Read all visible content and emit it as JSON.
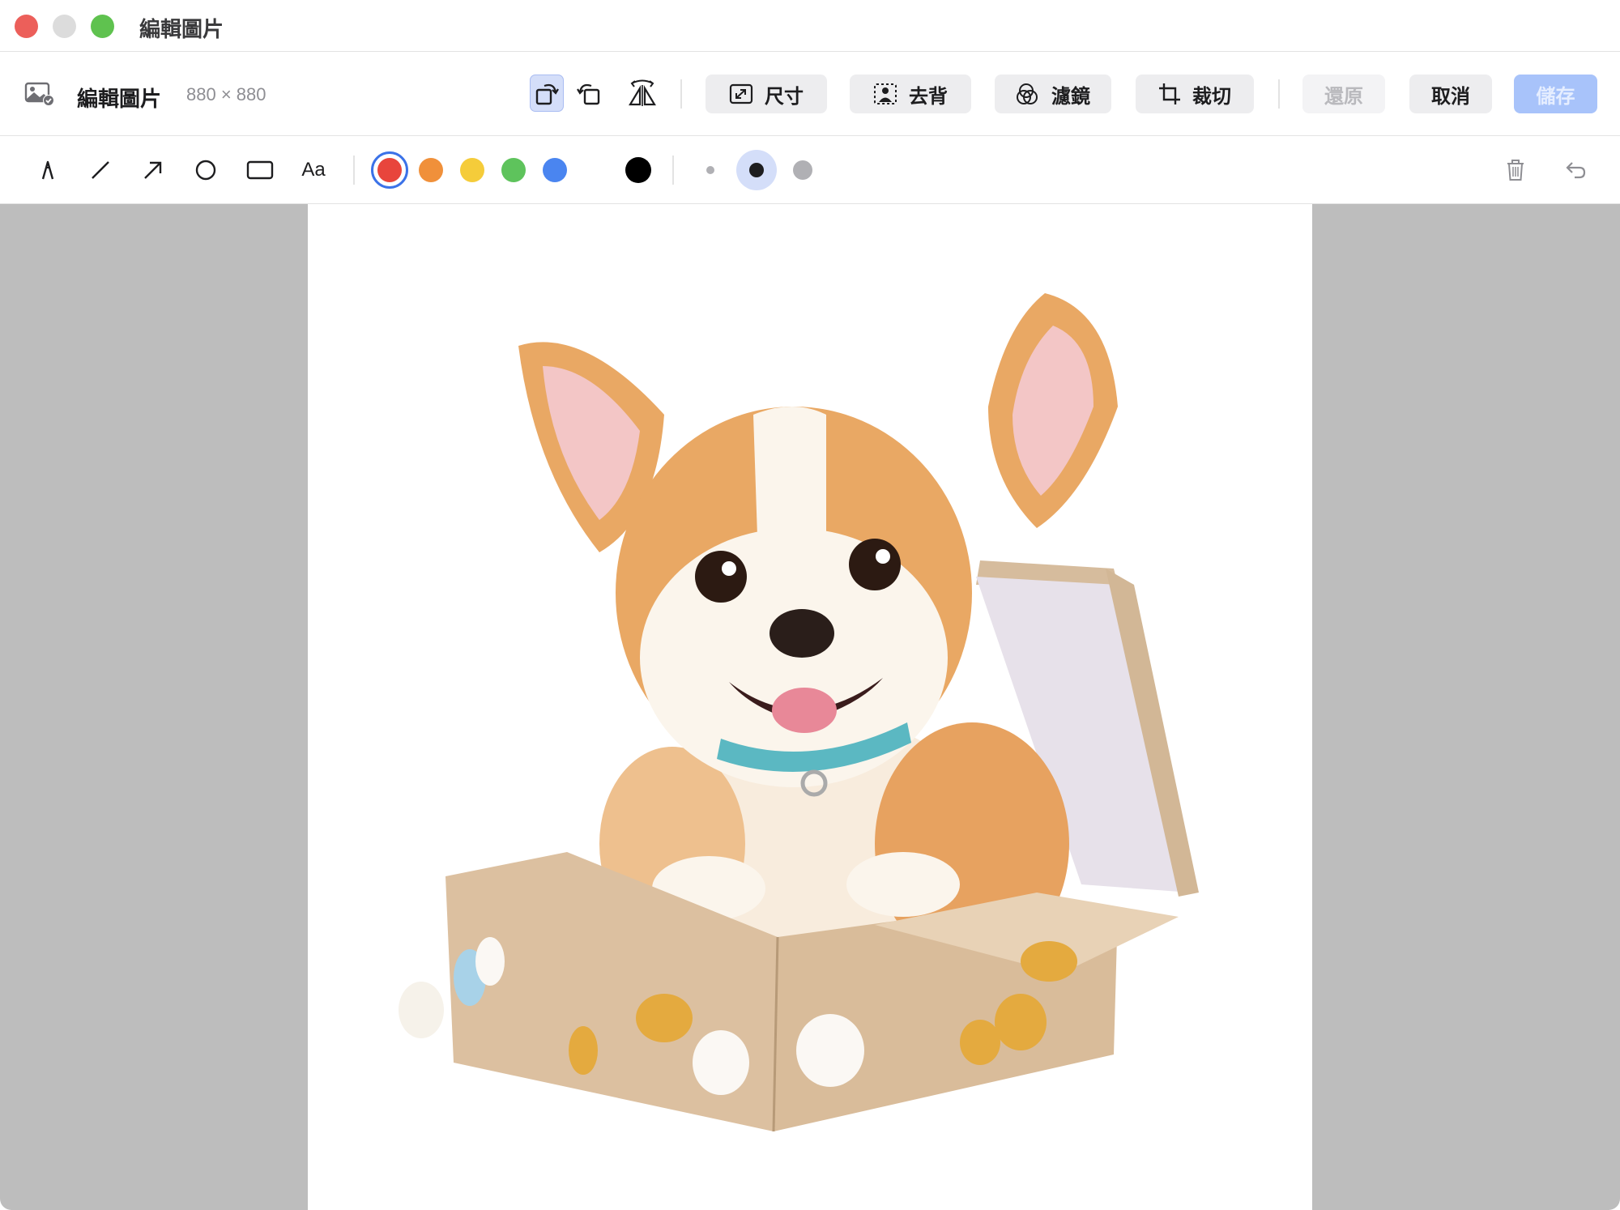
{
  "window": {
    "title": "編輯圖片"
  },
  "document": {
    "name": "編輯圖片",
    "dimensions": "880 × 880"
  },
  "toolbar": {
    "size_label": "尺寸",
    "remove_bg_label": "去背",
    "filter_label": "濾鏡",
    "crop_label": "裁切",
    "revert_label": "還原",
    "cancel_label": "取消",
    "save_label": "儲存"
  },
  "markup": {
    "text_tool_label": "Aa",
    "colors": [
      "#e8453c",
      "#f0903a",
      "#f5cc3a",
      "#5ec35c",
      "#4a85f0",
      "#000000"
    ],
    "selected_color": "#e8453c",
    "stroke_sizes": [
      "small",
      "medium",
      "large"
    ],
    "selected_stroke": "medium"
  },
  "icons": {
    "title_icon": "photo-edit-icon",
    "rotate_left": "rotate-left-icon",
    "rotate_right": "rotate-right-icon",
    "flip": "flip-horizontal-icon",
    "resize": "resize-icon",
    "remove_bg": "remove-background-icon",
    "filter": "filter-icon",
    "crop": "crop-icon",
    "delete": "trash-icon",
    "undo": "undo-icon"
  },
  "image": {
    "subject": "corgi puppy in cardboard box"
  },
  "accent_color": "#3b72e8"
}
